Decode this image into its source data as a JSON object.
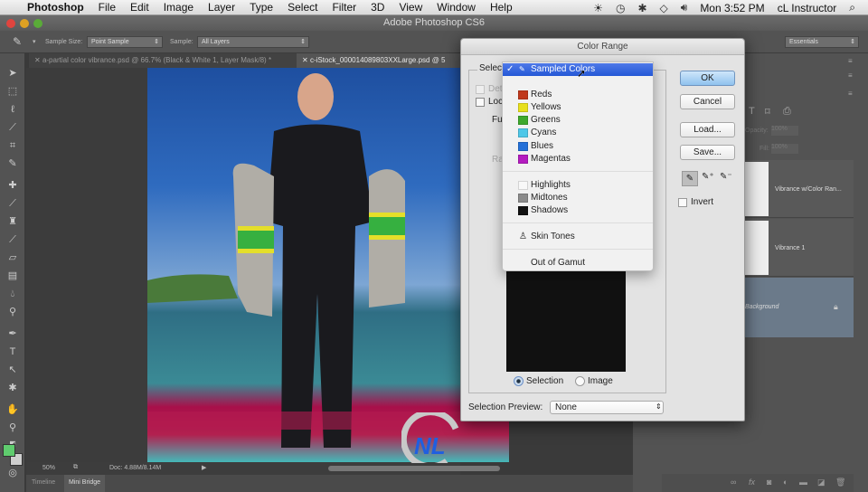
{
  "menubar": {
    "app": "Photoshop",
    "items": [
      "File",
      "Edit",
      "Image",
      "Layer",
      "Type",
      "Select",
      "Filter",
      "3D",
      "View",
      "Window",
      "Help"
    ],
    "clock": "Mon 3:52 PM",
    "user": "cL Instructor"
  },
  "window": {
    "title": "Adobe Photoshop CS6"
  },
  "options_bar": {
    "sample_size_label": "Sample Size:",
    "sample_size_value": "Point Sample",
    "sample_label": "Sample:",
    "sample_value": "All Layers",
    "workspace": "Essentials"
  },
  "doc_tabs": [
    {
      "label": "a-partial color vibrance.psd @ 66.7% (Black & White 1, Layer Mask/8) *",
      "active": false
    },
    {
      "label": "c-iStock_000014089803XXLarge.psd @ 5",
      "active": true
    }
  ],
  "status_bar": {
    "zoom": "50%",
    "doc": "Doc: 4.88M/8.14M"
  },
  "bottom_tabs": [
    "Timeline",
    "Mini Bridge"
  ],
  "layers": {
    "opacity_label": "Opacity:",
    "opacity_value": "100%",
    "fill_label": "Fill:",
    "fill_value": "100%",
    "items": [
      {
        "name": "Vibrance w/Color Ran..."
      },
      {
        "name": "Vibrance 1"
      },
      {
        "name": "Background"
      }
    ]
  },
  "dialog": {
    "title": "Color Range",
    "select_label": "Select:",
    "detect_faces_label": "Detect Faces",
    "localized_label": "Localized Color Clusters",
    "fuzziness_label": "Fuzziness:",
    "range_label": "Range:",
    "ok": "OK",
    "cancel": "Cancel",
    "load": "Load...",
    "save": "Save...",
    "invert_label": "Invert",
    "radio_selection": "Selection",
    "radio_image": "Image",
    "radio_selected": "Selection",
    "preview_label": "Selection Preview:",
    "preview_value": "None"
  },
  "select_menu": {
    "selected": "Sampled Colors",
    "items": [
      {
        "label": "Sampled Colors",
        "color": null
      },
      {
        "label": "Reds",
        "color": "#c0391c"
      },
      {
        "label": "Yellows",
        "color": "#e8e01c"
      },
      {
        "label": "Greens",
        "color": "#3ea82c"
      },
      {
        "label": "Cyans",
        "color": "#4ec7e8"
      },
      {
        "label": "Blues",
        "color": "#2470d8"
      },
      {
        "label": "Magentas",
        "color": "#b41cc0"
      },
      {
        "label": "Highlights",
        "color": "#f8f8f8"
      },
      {
        "label": "Midtones",
        "color": "#8a8a8a"
      },
      {
        "label": "Shadows",
        "color": "#111111"
      },
      {
        "label": "Skin Tones",
        "color": null
      },
      {
        "label": "Out of Gamut",
        "color": null
      }
    ]
  },
  "foreground_color": "#5fcc6e",
  "background_color": "#cfcfcf"
}
